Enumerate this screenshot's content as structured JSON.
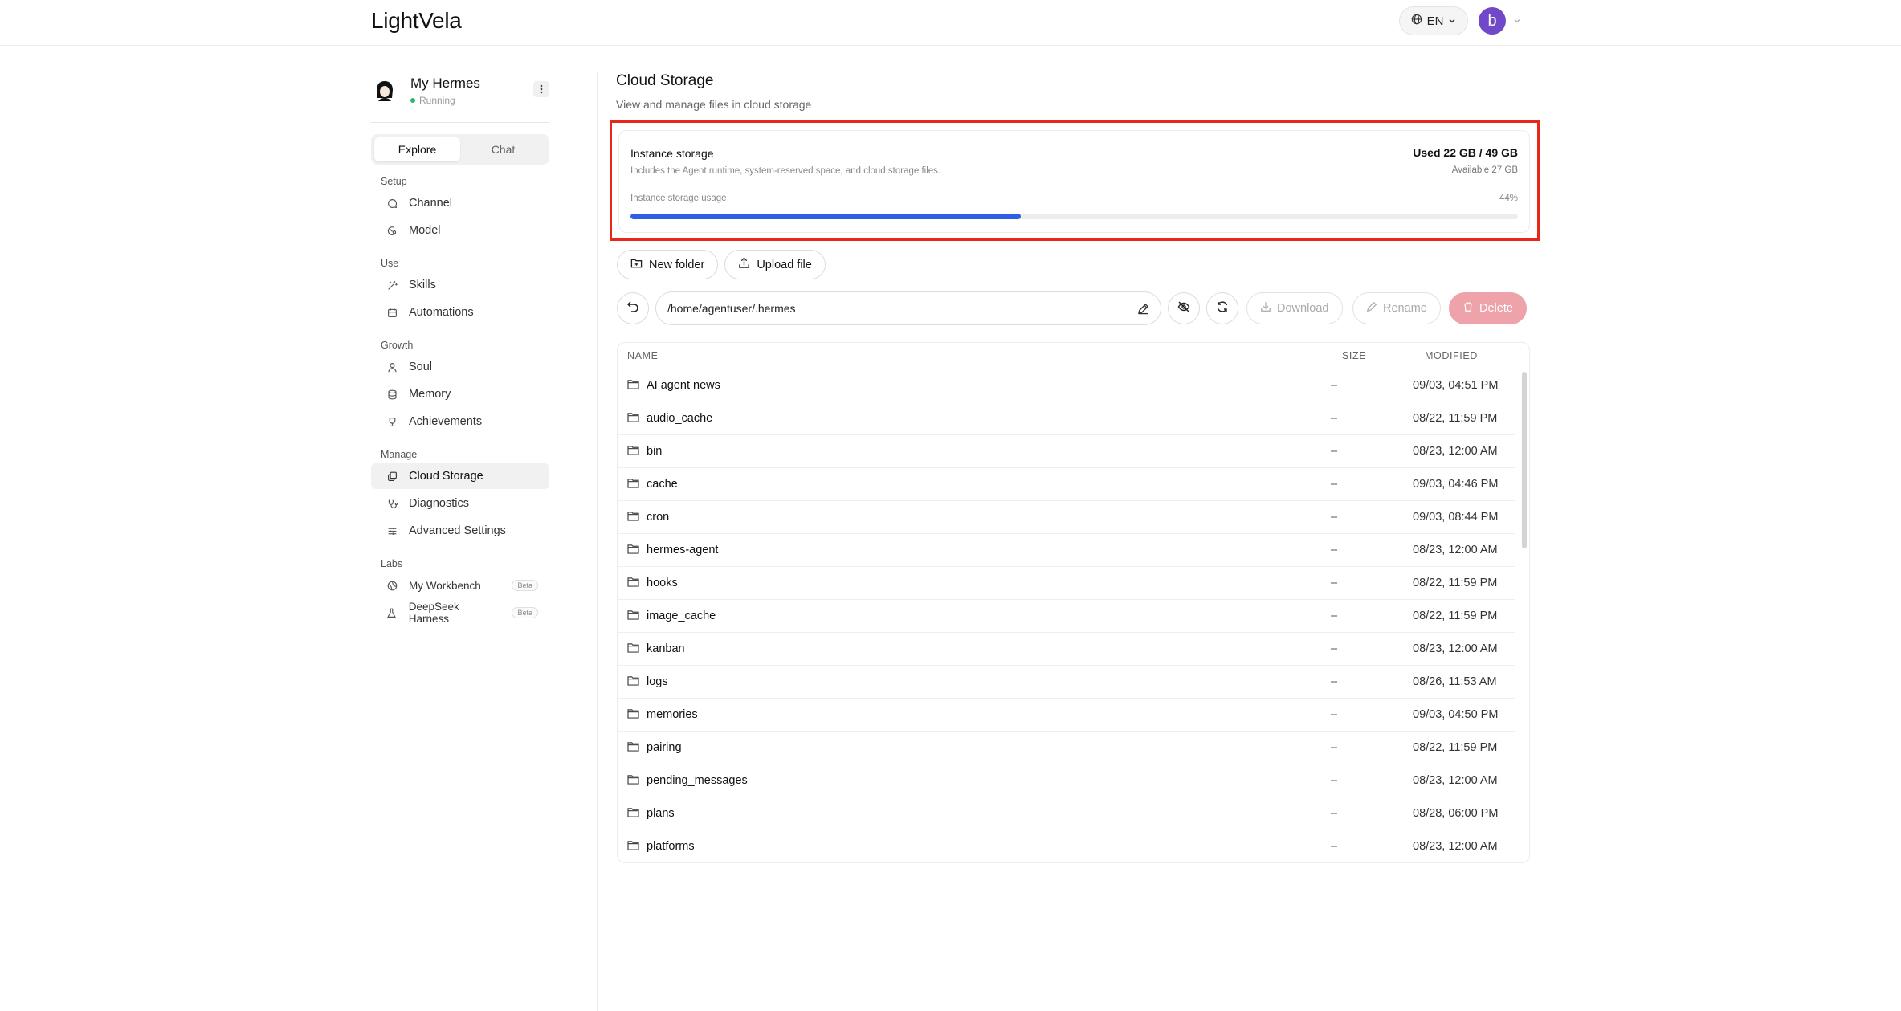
{
  "app": {
    "logo": "LightVela"
  },
  "topbar": {
    "language": "EN",
    "avatar_letter": "b"
  },
  "agent": {
    "name": "My Hermes",
    "status": "Running"
  },
  "tabs": [
    {
      "label": "Explore"
    },
    {
      "label": "Chat"
    }
  ],
  "sidebar": {
    "sections": [
      {
        "label": "Setup",
        "items": [
          {
            "label": "Channel",
            "icon": "chat-bubble-icon"
          },
          {
            "label": "Model",
            "icon": "model-icon"
          }
        ]
      },
      {
        "label": "Use",
        "items": [
          {
            "label": "Skills",
            "icon": "wand-icon"
          },
          {
            "label": "Automations",
            "icon": "calendar-icon"
          }
        ]
      },
      {
        "label": "Growth",
        "items": [
          {
            "label": "Soul",
            "icon": "person-icon"
          },
          {
            "label": "Memory",
            "icon": "database-icon"
          },
          {
            "label": "Achievements",
            "icon": "trophy-icon"
          }
        ]
      },
      {
        "label": "Manage",
        "items": [
          {
            "label": "Cloud Storage",
            "icon": "storage-icon",
            "active": true
          },
          {
            "label": "Diagnostics",
            "icon": "stethoscope-icon"
          },
          {
            "label": "Advanced Settings",
            "icon": "sliders-icon"
          }
        ]
      },
      {
        "label": "Labs",
        "items": [
          {
            "label": "My Workbench",
            "icon": "globe-icon",
            "badge": "Beta"
          },
          {
            "label": "DeepSeek Harness",
            "icon": "flask-icon",
            "badge": "Beta"
          }
        ]
      }
    ]
  },
  "page": {
    "title": "Cloud Storage",
    "subtitle": "View and manage files in cloud storage"
  },
  "storage": {
    "title": "Instance storage",
    "description": "Includes the Agent runtime, system-reserved space, and cloud storage files.",
    "used": "Used 22 GB / 49 GB",
    "available": "Available 27 GB",
    "usage_label": "Instance storage usage",
    "percent_label": "44%",
    "percent": 44
  },
  "toolbar": {
    "new_folder": "New folder",
    "upload_file": "Upload file"
  },
  "path": {
    "value": "/home/agentuser/.hermes"
  },
  "ops": {
    "download": "Download",
    "rename": "Rename",
    "delete": "Delete"
  },
  "table": {
    "headers": {
      "name": "NAME",
      "size": "SIZE",
      "modified": "MODIFIED"
    },
    "rows": [
      {
        "name": "AI agent news",
        "size": "–",
        "modified": "09/03, 04:51 PM"
      },
      {
        "name": "audio_cache",
        "size": "–",
        "modified": "08/22, 11:59 PM"
      },
      {
        "name": "bin",
        "size": "–",
        "modified": "08/23, 12:00 AM"
      },
      {
        "name": "cache",
        "size": "–",
        "modified": "09/03, 04:46 PM"
      },
      {
        "name": "cron",
        "size": "–",
        "modified": "09/03, 08:44 PM"
      },
      {
        "name": "hermes-agent",
        "size": "–",
        "modified": "08/23, 12:00 AM"
      },
      {
        "name": "hooks",
        "size": "–",
        "modified": "08/22, 11:59 PM"
      },
      {
        "name": "image_cache",
        "size": "–",
        "modified": "08/22, 11:59 PM"
      },
      {
        "name": "kanban",
        "size": "–",
        "modified": "08/23, 12:00 AM"
      },
      {
        "name": "logs",
        "size": "–",
        "modified": "08/26, 11:53 AM"
      },
      {
        "name": "memories",
        "size": "–",
        "modified": "09/03, 04:50 PM"
      },
      {
        "name": "pairing",
        "size": "–",
        "modified": "08/22, 11:59 PM"
      },
      {
        "name": "pending_messages",
        "size": "–",
        "modified": "08/23, 12:00 AM"
      },
      {
        "name": "plans",
        "size": "–",
        "modified": "08/28, 06:00 PM"
      },
      {
        "name": "platforms",
        "size": "–",
        "modified": "08/23, 12:00 AM"
      }
    ]
  },
  "colors": {
    "accent": "#2e5fe6",
    "highlight": "#e8271b",
    "delete": "#eea3ab",
    "avatar": "#7048c8",
    "status": "#2bb673"
  }
}
